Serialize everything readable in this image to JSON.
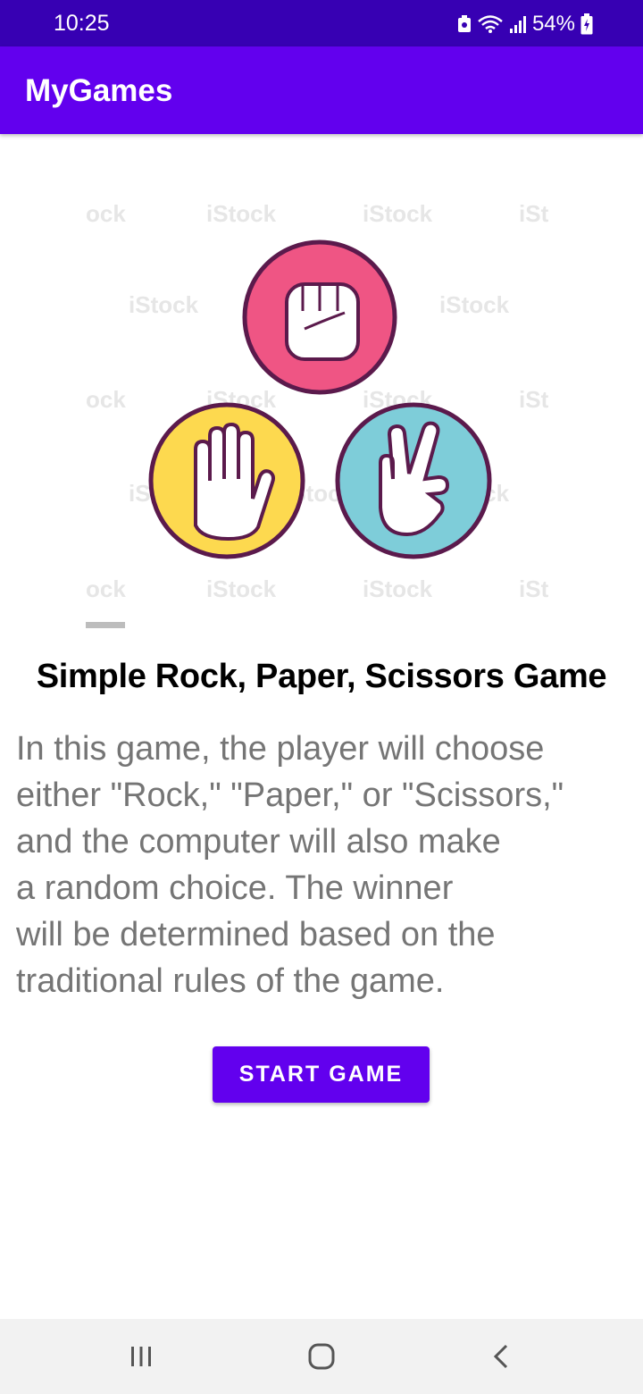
{
  "status_bar": {
    "time": "10:25",
    "battery": "54%",
    "icons": [
      "screenshot-icon",
      "wifi-icon",
      "signal-icon",
      "battery-charging-icon"
    ]
  },
  "app_bar": {
    "title": "MyGames"
  },
  "hero": {
    "gestures": [
      "rock-fist-icon",
      "paper-hand-icon",
      "scissors-hand-icon"
    ],
    "colors": {
      "rock": "#ef5584",
      "paper": "#fdd94f",
      "scissors": "#7ecdd9",
      "outline": "#5b1a4c"
    },
    "watermark": "iStock"
  },
  "main": {
    "title": "Simple Rock, Paper, Scissors Game",
    "description_lines": [
      "In this game, the player will choose",
      "either \"Rock,\" \"Paper,\" or \"Scissors,\"",
      "and the computer will also make",
      "a random choice. The winner",
      "will be determined based on the",
      "traditional rules of the game."
    ],
    "start_label": "START GAME"
  },
  "nav_bar": {
    "buttons": [
      "recents-icon",
      "home-icon",
      "back-icon"
    ]
  },
  "theme": {
    "primary": "#6200ee",
    "primary_dark": "#3700b3",
    "text_secondary": "#757575"
  }
}
